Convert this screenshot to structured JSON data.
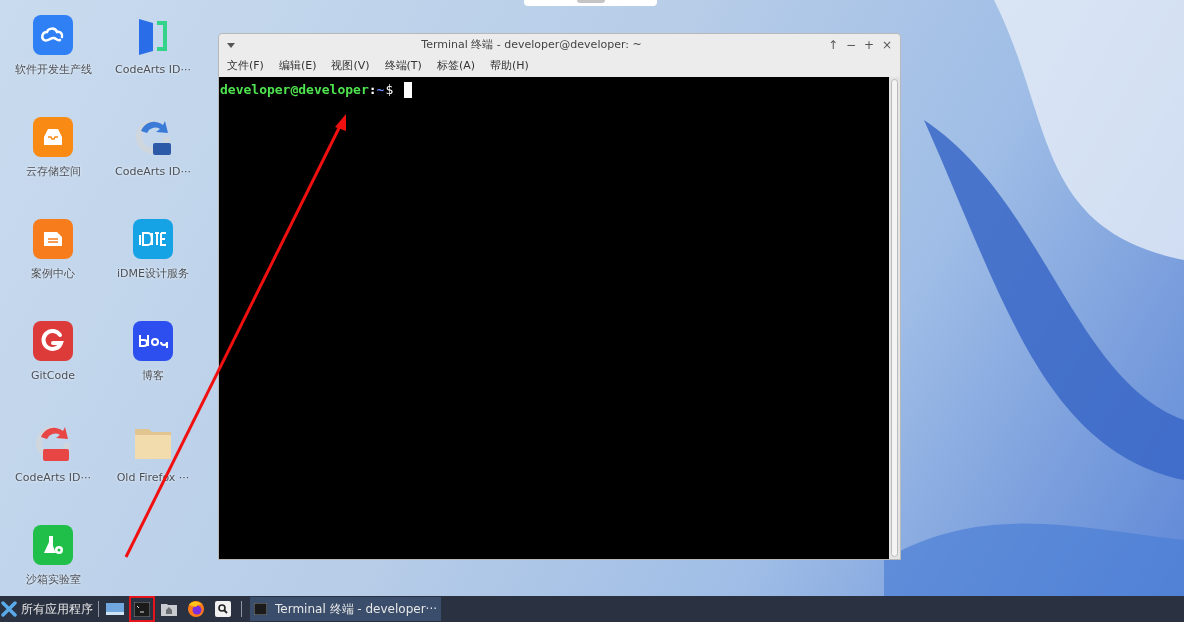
{
  "desktop_icons": [
    {
      "label": "软件开发生产线",
      "kind": "cloud"
    },
    {
      "label": "CodeArts ID···",
      "kind": "ide"
    },
    {
      "label": "云存储空间",
      "kind": "storage"
    },
    {
      "label": "CodeArts ID···",
      "kind": "python"
    },
    {
      "label": "案例中心",
      "kind": "cases"
    },
    {
      "label": "iDME设计服务",
      "kind": "idme"
    },
    {
      "label": "GitCode",
      "kind": "gitcode"
    },
    {
      "label": "博客",
      "kind": "blog"
    },
    {
      "label": "CodeArts ID···",
      "kind": "java"
    },
    {
      "label": "Old Firefox ···",
      "kind": "folder"
    },
    {
      "label": "沙箱实验室",
      "kind": "lab"
    }
  ],
  "terminal": {
    "title": "Terminal 终端 - developer@developer: ~",
    "controls": [
      "↑",
      "−",
      "+",
      "×"
    ],
    "menu": [
      "文件(F)",
      "编辑(E)",
      "视图(V)",
      "终端(T)",
      "标签(A)",
      "帮助(H)"
    ],
    "prompt": {
      "user_host": "developer@developer",
      "separator": ":",
      "path": "~",
      "symbol": "$"
    }
  },
  "taskbar": {
    "start_label": "所有应用程序",
    "launchers": [
      {
        "kind": "desktop",
        "highlighted": false
      },
      {
        "kind": "terminal",
        "highlighted": true
      },
      {
        "kind": "home",
        "highlighted": false
      },
      {
        "kind": "firefox",
        "highlighted": false
      },
      {
        "kind": "search",
        "highlighted": false
      }
    ],
    "tasks": [
      {
        "label": "Terminal 终端 - developer···",
        "selected": true
      }
    ]
  }
}
